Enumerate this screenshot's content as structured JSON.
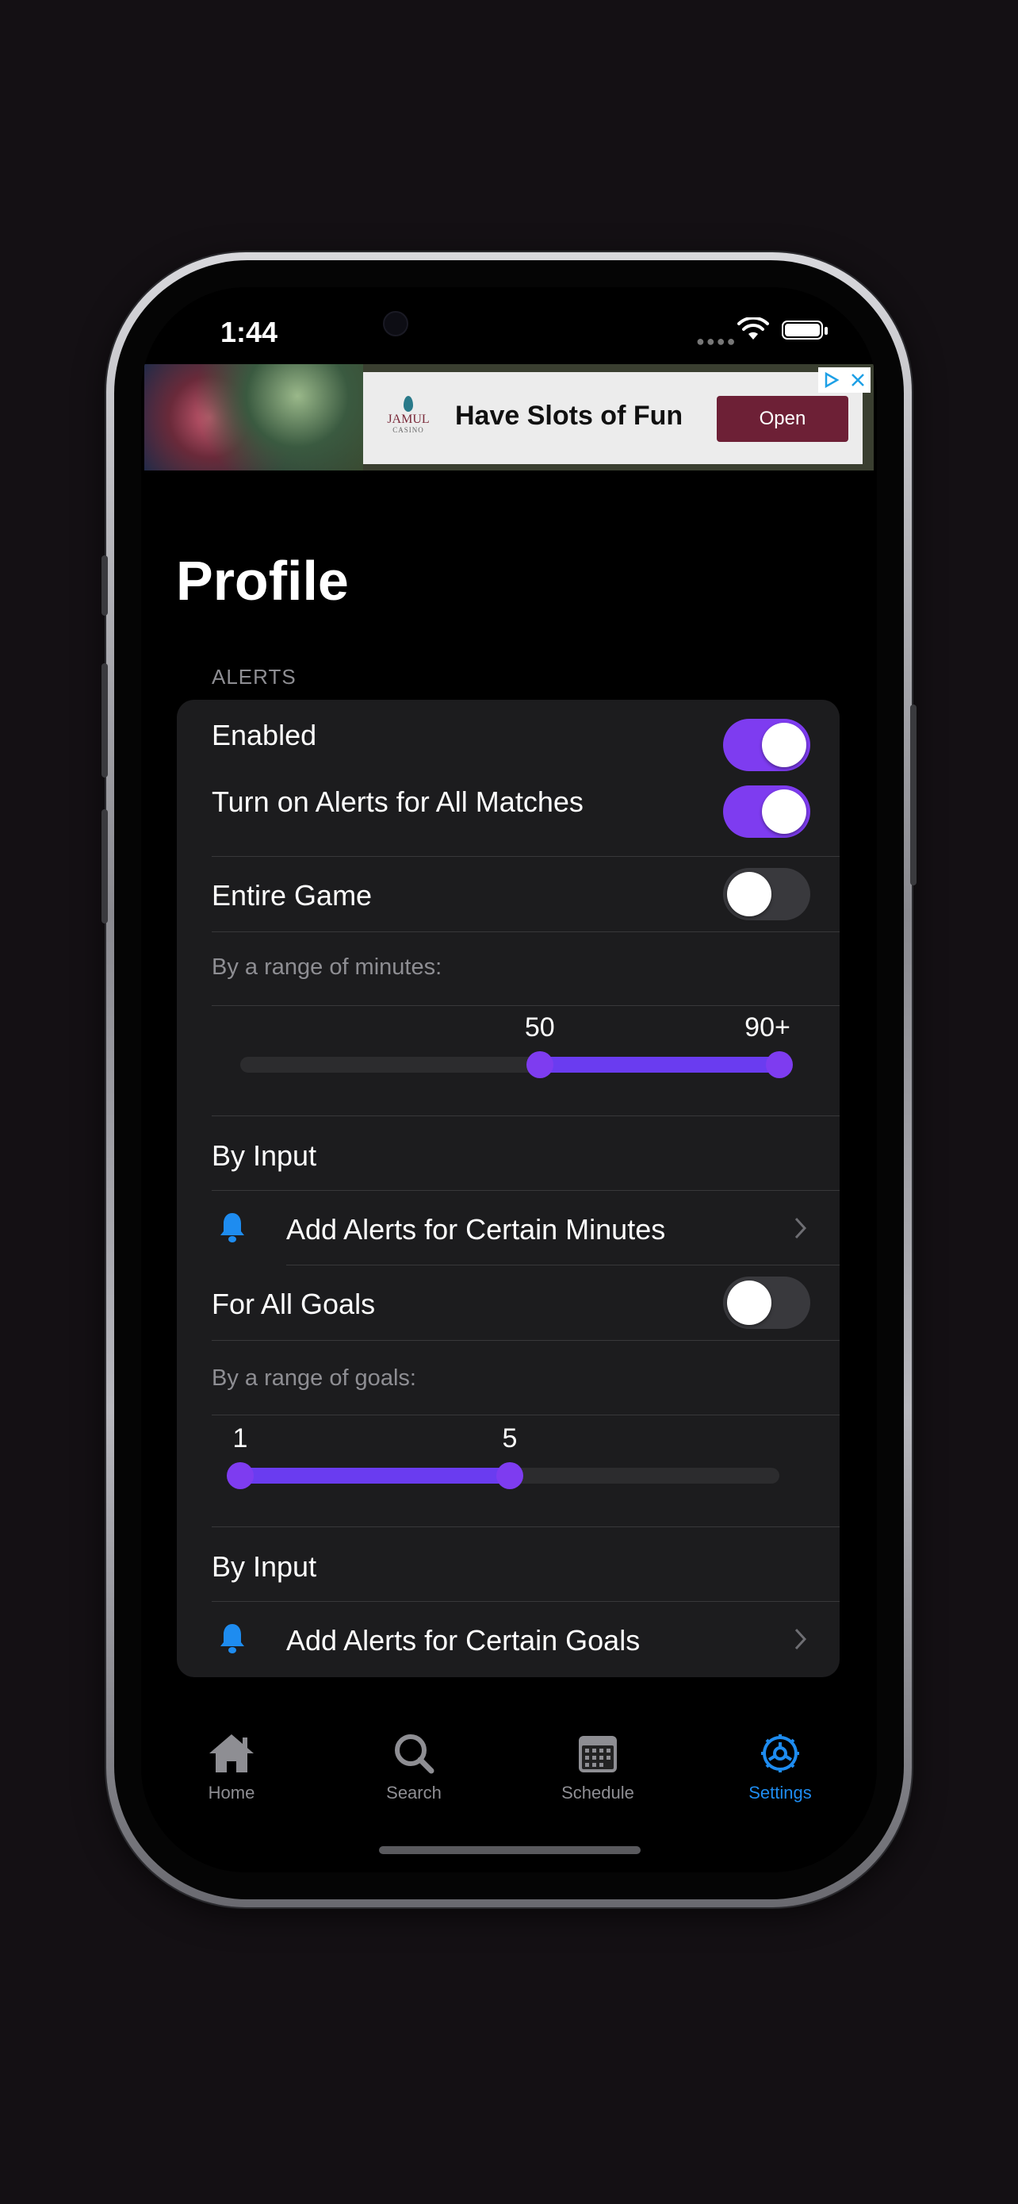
{
  "status_bar": {
    "time": "1:44"
  },
  "ad": {
    "logo": "JAMUL",
    "logo_sub": "CASINO",
    "headline": "Have Slots of Fun",
    "cta": "Open"
  },
  "page": {
    "title": "Profile"
  },
  "alerts": {
    "section_header": "ALERTS",
    "enabled": {
      "label": "Enabled",
      "on": true
    },
    "all_matches": {
      "label": "Turn on Alerts for All Matches",
      "on": true
    },
    "entire_game": {
      "label": "Entire Game",
      "on": false
    },
    "minutes_range": {
      "label": "By a range of minutes:",
      "low_label": "50",
      "high_label": "90+",
      "min": 0,
      "max": 90,
      "low": 50,
      "high": 90
    },
    "by_input_1": "By Input",
    "add_minutes": "Add Alerts for Certain Minutes",
    "all_goals": {
      "label": "For All Goals",
      "on": false
    },
    "goals_range": {
      "label": "By a range of goals:",
      "low_label": "1",
      "high_label": "5",
      "min": 1,
      "max": 9,
      "low": 1,
      "high": 5
    },
    "by_input_2": "By Input",
    "add_goals": "Add Alerts for Certain Goals"
  },
  "tabbar": {
    "tabs": [
      {
        "label": "Home",
        "icon": "house-icon"
      },
      {
        "label": "Search",
        "icon": "magnifier-icon"
      },
      {
        "label": "Schedule",
        "icon": "calendar-icon"
      },
      {
        "label": "Settings",
        "icon": "gear-icon",
        "active": true
      }
    ]
  },
  "colors": {
    "accent": "#7e3cf0",
    "tab_active": "#1e8cf0",
    "card": "#1c1c1e",
    "ad_button": "#6d2036"
  }
}
